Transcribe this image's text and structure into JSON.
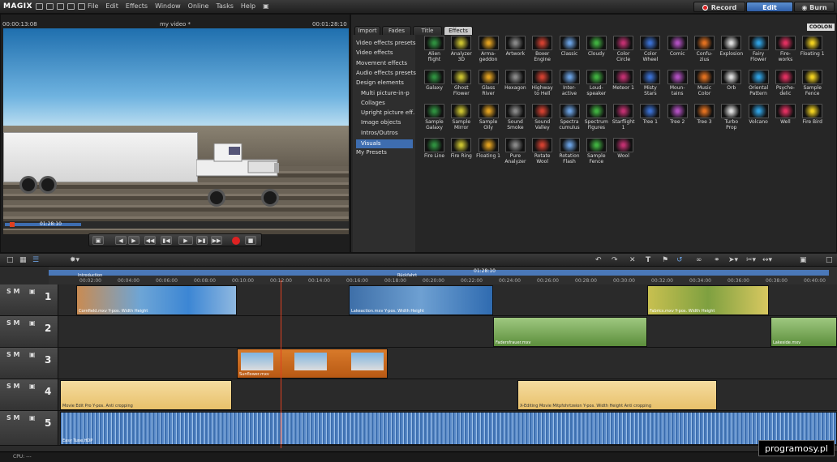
{
  "app": {
    "logo": "MAGIX"
  },
  "menu": [
    "File",
    "Edit",
    "Effects",
    "Window",
    "Online",
    "Tasks",
    "Help"
  ],
  "modes": {
    "record": "Record",
    "edit": "Edit",
    "burn": "Burn"
  },
  "preview": {
    "time_left": "00:00:13:08",
    "title": "my video *",
    "time_right": "00:01:28:10",
    "pos": "01:28:10"
  },
  "pool": {
    "tabs": [
      "Import",
      "Fades",
      "Title",
      "Effects"
    ],
    "active_tab": "Effects",
    "brand": "COOLON",
    "categories": [
      {
        "label": "Video effects presets",
        "sub": false
      },
      {
        "label": "Video effects",
        "sub": false
      },
      {
        "label": "Movement effects",
        "sub": false
      },
      {
        "label": "Audio effects presets",
        "sub": false
      },
      {
        "label": "Design elements",
        "sub": false
      },
      {
        "label": "Multi picture-in-p",
        "sub": true
      },
      {
        "label": "Collages",
        "sub": true
      },
      {
        "label": "Upright picture eff.",
        "sub": true
      },
      {
        "label": "Image objects",
        "sub": true
      },
      {
        "label": "Intros/Outros",
        "sub": true
      },
      {
        "label": "Visuals",
        "sub": true,
        "selected": true
      },
      {
        "label": "My Presets",
        "sub": false
      }
    ],
    "effects": [
      "Alien\nflight",
      "Analyzer\n3D",
      "Arma-\ngeddon",
      "Artwork",
      "Boxer\nEngine",
      "Classic",
      "Cloudy",
      "Color\nCircle",
      "Color\nWheel",
      "Comic",
      "Confu-\nzius",
      "Explosion",
      "Fairy\nFlower",
      "Fire-\nworks",
      "Floating 1",
      "Galaxy",
      "Ghost\nFlower",
      "Glass\nRiver",
      "Hexagon",
      "Highway\nto Hell",
      "Inter-\nactive",
      "Loud-\nspeaker",
      "Meteor 1",
      "Misty\nStars",
      "Moun-\ntains",
      "Music\nColor",
      "Orb",
      "Oriental\nPattern",
      "Psyche-\ndelic",
      "Sample\nFence",
      "Sample\nGalaxy",
      "Sample\nMirror",
      "Sample\nOily",
      "Sound\nSmoke",
      "Sound\nValley",
      "Spectra\ncumulus",
      "Spectrum\nFigures",
      "Starflight\n1",
      "Tree 1",
      "Tree 2",
      "Tree 3",
      "Turbo\nProp",
      "Volcano",
      "Well",
      "Fire Bird",
      "Fire Line",
      "Fire Ring",
      "Floating 1",
      "Pure\nAnalyzer",
      "Rotate\nWool",
      "Rotation\nFlash",
      "Sample\nFence",
      "Wool"
    ]
  },
  "timeline": {
    "markers": [
      "Introduction",
      "Rückfahrt"
    ],
    "marker_time": "01:28:10",
    "ticks": [
      "00:02:00",
      "00:04:00",
      "00:06:00",
      "00:08:00",
      "00:10:00",
      "00:12:00",
      "00:14:00",
      "00:16:00",
      "00:18:00",
      "00:20:00",
      "00:22:00",
      "00:24:00",
      "00:26:00",
      "00:28:00",
      "00:30:00",
      "00:32:00",
      "00:34:00",
      "00:36:00",
      "00:38:00",
      "00:40:00"
    ],
    "tracks": [
      {
        "num": "1",
        "clips": [
          "Cornfield.mxv  Y-pos. Width Height",
          "Lakeaction.mxv  Y-pos. Width Height",
          "Fabrics.mxv  Y-pos. Width Height"
        ]
      },
      {
        "num": "2",
        "clips": [
          "Fadersfrauer.mxv",
          "Lakeside.mxv"
        ]
      },
      {
        "num": "3",
        "clips": [
          "Sunflower.mxv"
        ]
      },
      {
        "num": "4",
        "clips": [
          "Movie Edit Pro  Y-pos.  Anti cropping",
          "X-Editing Movie Mitpfohrtzeion  Y-pos.  Width  Height  Anti cropping"
        ]
      },
      {
        "num": "5",
        "clips": [
          "Easy Tune.HDP"
        ]
      }
    ],
    "sm": "S  M"
  },
  "status": {
    "cpu": "CPU: ---"
  },
  "watermark": "programosy.pl",
  "colors": {
    "accent": "#3e6db0",
    "playhead": "#e04020",
    "record": "#d22222"
  }
}
